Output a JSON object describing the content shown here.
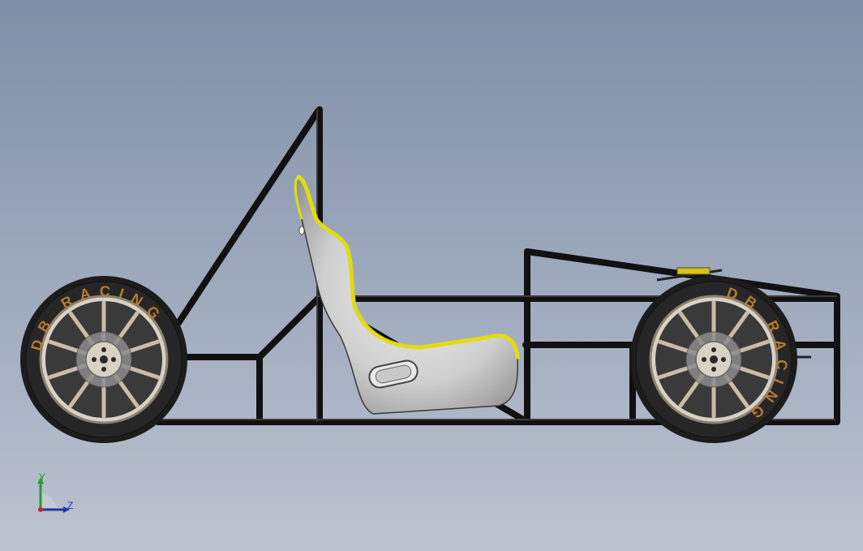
{
  "viewport": {
    "background_top": "#7f8fa7",
    "background_bottom": "#bcc3d0"
  },
  "model": {
    "frame_color": "#111111",
    "seat_color": "#d4d4d4",
    "seat_trim_color": "#e2dc10",
    "tire_color": "#1c1c1c",
    "rim_color": "#c9bca4",
    "tire_lettering_color": "#b87a2e",
    "front_tire_text": "DB RACING",
    "rear_tire_text": "DB RACING"
  },
  "triad": {
    "y_label": "Y",
    "z_label": "Z",
    "y_color": "#2a9a2a",
    "z_color": "#2233aa"
  }
}
